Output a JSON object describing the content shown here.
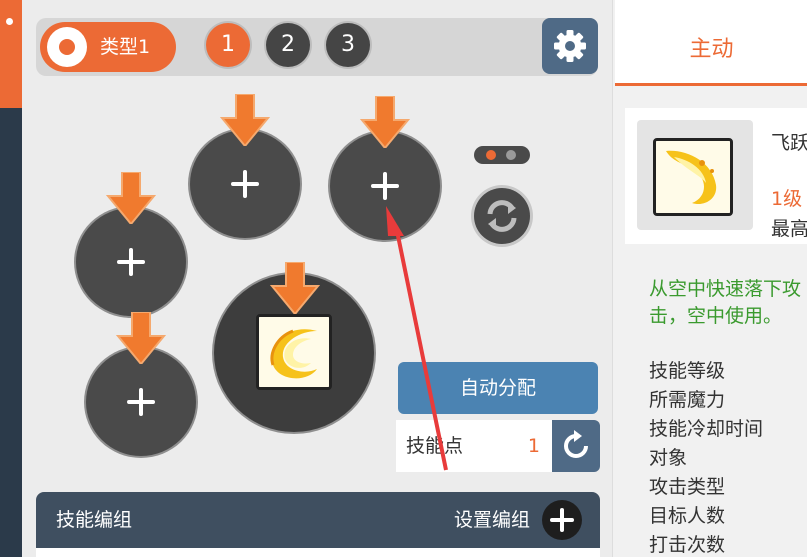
{
  "type_selector": {
    "label": "类型1"
  },
  "presets": [
    "1",
    "2",
    "3"
  ],
  "active_preset": "1",
  "auto_assign_label": "自动分配",
  "skill_points": {
    "label": "技能点",
    "value": "1"
  },
  "skill_group": {
    "title": "技能编组",
    "setting_label": "设置编组"
  },
  "right_panel": {
    "tab_label": "主动",
    "skill_name": "飞跃",
    "level_text": "1级",
    "max_text": "最高",
    "description": "从空中快速落下攻击，空中使用。",
    "stats": [
      "技能等级",
      "所需魔力",
      "技能冷却时间",
      "对象",
      "攻击类型",
      "目标人数",
      "打击次数"
    ]
  },
  "colors": {
    "accent": "#ec6a35",
    "dark_slot": "#4a4a4a",
    "blue_button": "#4b83b2",
    "steel_button": "#4f6a86",
    "description_green": "#3a9a2e",
    "pointer_red": "#e83b3b"
  },
  "icons": [
    "settings-gear-icon",
    "plus-icon",
    "down-arrow-icon",
    "refresh-icon",
    "reset-icon",
    "skill-flame-icon"
  ]
}
